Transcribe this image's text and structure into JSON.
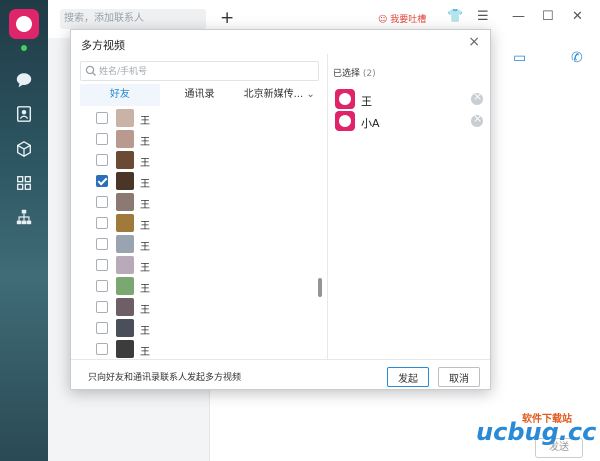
{
  "main": {
    "search_placeholder": "搜索，添加联系人",
    "add_symbol": "+",
    "feedback": "我要吐槽",
    "send_label": "发送"
  },
  "watermark": {
    "brand": "ucbug.cc",
    "sub": "软件下载站"
  },
  "dialog": {
    "title": "多方视频",
    "close": "×",
    "search_placeholder": "姓名/手机号",
    "tabs": [
      {
        "label": "好友",
        "active": true
      },
      {
        "label": "通讯录",
        "active": false
      },
      {
        "label": "北京新媒传...",
        "active": false
      }
    ],
    "contacts": [
      {
        "name": "王",
        "checked": false,
        "color": "#c9b2a6"
      },
      {
        "name": "王",
        "checked": false,
        "color": "#b89a8e"
      },
      {
        "name": "王",
        "checked": false,
        "color": "#6b4a33"
      },
      {
        "name": "王",
        "checked": true,
        "color": "#4a3526"
      },
      {
        "name": "王",
        "checked": false,
        "color": "#8c7a72"
      },
      {
        "name": "王",
        "checked": false,
        "color": "#a07a3a"
      },
      {
        "name": "王",
        "checked": false,
        "color": "#9aa4b0"
      },
      {
        "name": "王",
        "checked": false,
        "color": "#b8aab8"
      },
      {
        "name": "王",
        "checked": false,
        "color": "#7aa870"
      },
      {
        "name": "王",
        "checked": false,
        "color": "#6e5e66"
      },
      {
        "name": "王",
        "checked": false,
        "color": "#4a4f5a"
      },
      {
        "name": "王",
        "checked": false,
        "color": "#3c3c3c"
      }
    ],
    "selected_label": "已选择",
    "selected_count": "(2)",
    "selected": [
      {
        "name": "王"
      },
      {
        "name": "小A"
      }
    ],
    "footer_note": "只向好友和通讯录联系人发起多方视频",
    "start_label": "发起",
    "cancel_label": "取消"
  }
}
